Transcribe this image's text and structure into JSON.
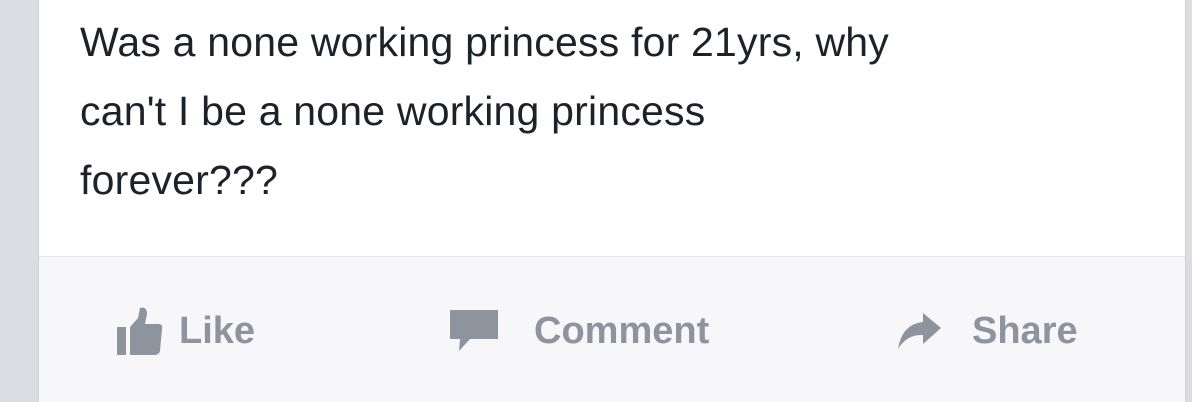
{
  "post": {
    "text_lines": [
      "Was a none working princess for 21yrs, why",
      "can't I be a none working princess",
      "forever???"
    ]
  },
  "actions": {
    "like": {
      "label": "Like",
      "icon": "thumbs-up-icon"
    },
    "comment": {
      "label": "Comment",
      "icon": "speech-bubble-icon"
    },
    "share": {
      "label": "Share",
      "icon": "share-arrow-icon"
    }
  },
  "colors": {
    "text": "#1d2129",
    "action_gray": "#8d949e",
    "card_bg": "#ffffff",
    "action_bar_bg": "#f7f7f9",
    "page_bg": "#dcdde2"
  }
}
